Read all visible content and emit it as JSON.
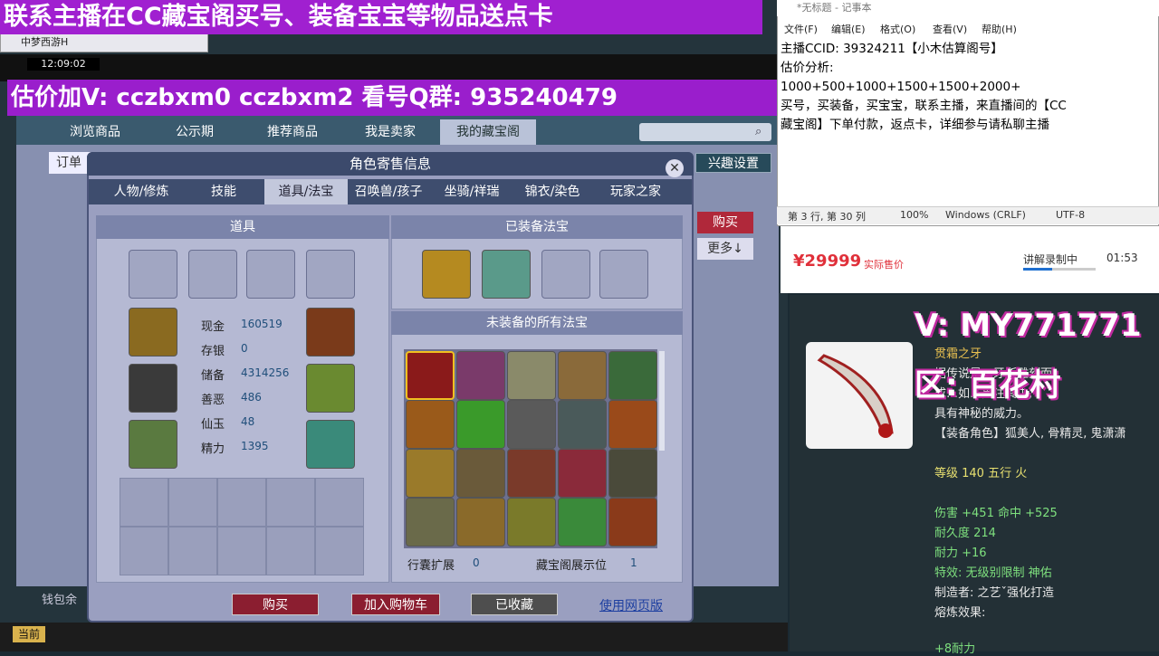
{
  "banner": {
    "top": "联系主播在CC藏宝阁买号、装备宝宝等物品送点卡",
    "mid": "估价加V:   cczbxm0   cczbxm2   看号Q群: 935240479"
  },
  "game": {
    "clock": "12:09:02",
    "browser_tab": "中梦西游H",
    "current_button": "当前",
    "wallet_label": "钱包余"
  },
  "shop": {
    "nav_tabs": [
      "浏览商品",
      "公示期",
      "推荐商品",
      "我是卖家",
      "我的藏宝阁"
    ],
    "order_label": "订单",
    "interest_button": "兴趣设置",
    "buy_button": "购买",
    "more_button": "更多↓"
  },
  "dialog": {
    "title": "角色寄售信息",
    "close": "✕",
    "tabs": [
      "人物/修炼",
      "技能",
      "道具/法宝",
      "召唤兽/孩子",
      "坐骑/祥瑞",
      "锦衣/染色",
      "玩家之家"
    ],
    "active_tab": 2,
    "items_header": "道具",
    "equipped_header": "已装备法宝",
    "unequipped_header": "未装备的所有法宝",
    "stats": [
      {
        "label": "现金",
        "value": "160519"
      },
      {
        "label": "存银",
        "value": "0"
      },
      {
        "label": "储备",
        "value": "4314256"
      },
      {
        "label": "善恶",
        "value": "486"
      },
      {
        "label": "仙玉",
        "value": "48"
      },
      {
        "label": "精力",
        "value": "1395"
      }
    ],
    "bag_expand_label": "行囊扩展",
    "bag_expand_value": "0",
    "display_label": "藏宝阁展示位",
    "display_value": "1",
    "buttons": {
      "buy": "购买",
      "cart": "加入购物车",
      "collected": "已收藏",
      "web": "使用网页版"
    }
  },
  "notepad": {
    "title": "*无标题 - 记事本",
    "menu": [
      "文件(F)",
      "编辑(E)",
      "格式(O)",
      "查看(V)",
      "帮助(H)"
    ],
    "text": "主播CCID: 39324211【小木估算阁号】\n估价分析:\n1000+500+1000+1500+1500+2000+\n买号，买装备，买宝宝，联系主播，来直播间的【CC\n藏宝阁】下单付款，返点卡，详细参与请私聊主播",
    "status": {
      "position": "第 3 行, 第 30 列",
      "zoom": "100%",
      "eol": "Windows (CRLF)",
      "encoding": "UTF-8"
    }
  },
  "live": {
    "price": "¥29999",
    "price_label": "实际售价",
    "recording_label": "讲解录制中",
    "recording_time": "01:53",
    "recording_progress": 0.4
  },
  "detail": {
    "v_overlay": "V: MY771771",
    "qu_overlay": "区: 百花村",
    "name": "贯霜之牙",
    "desc1": "据传说是…牙所雕刻而",
    "desc2": "成…如…贯注其中,",
    "desc3": "具有神秘的威力。",
    "roles": "【装备角色】狐美人, 骨精灵, 鬼潇潇",
    "level": "等级 140 五行 火",
    "attack": "伤害 +451 命中 +525",
    "durability": "耐久度 214",
    "stamina": "耐力 +16",
    "effect": "特效: 无级别限制 神佑",
    "maker": "制造者: 之艺ˇ强化打造",
    "forge": "熔炼效果:",
    "forge_val": "+8耐力"
  }
}
